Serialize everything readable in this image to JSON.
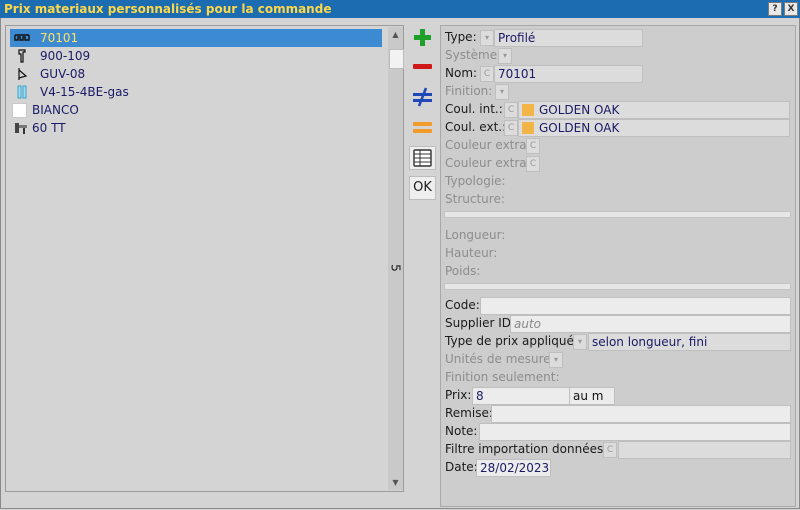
{
  "window": {
    "title": "Prix materiaux personnalisés pour la commande",
    "help_label": "?",
    "close_label": "X"
  },
  "list": {
    "items": [
      {
        "label": "70101",
        "icon": "profile-icon",
        "selected": true
      },
      {
        "label": "900-109",
        "icon": "profile-section-icon"
      },
      {
        "label": "GUV-08",
        "icon": "gasket-icon"
      },
      {
        "label": "V4-15-4BE-gas",
        "icon": "glass-icon"
      },
      {
        "label": "BIANCO",
        "icon": "color-white-icon"
      },
      {
        "label": "60 TT",
        "icon": "hardware-icon"
      }
    ],
    "count": "5"
  },
  "toolbar": {
    "ok_label": "OK"
  },
  "form": {
    "type_label": "Type:",
    "type_value": "Profilé",
    "system_label": "Système:",
    "name_label": "Nom:",
    "name_value": "70101",
    "finish_label": "Finition:",
    "int_color_label": "Coul. int.:",
    "int_color_value": "GOLDEN OAK",
    "ext_color_label": "Coul. ext.:",
    "ext_color_value": "GOLDEN OAK",
    "extra_color1_label": "Couleur extra:",
    "extra_color2_label": "Couleur extra:",
    "typology_label": "Typologie:",
    "structure_label": "Structure:",
    "length_label": "Longueur:",
    "height_label": "Hauteur:",
    "weight_label": "Poids:",
    "code_label": "Code:",
    "supplier_label": "Supplier ID:",
    "supplier_placeholder": "auto",
    "price_type_label": "Type de prix appliqué:",
    "price_type_value": "selon longueur, fini",
    "units_label": "Unités de mesure:",
    "finish_only_label": "Finition seulement:",
    "price_label": "Prix:",
    "price_value": "8",
    "price_unit": "au m",
    "discount_label": "Remise:",
    "note_label": "Note:",
    "import_filter_label": "Filtre importation données:",
    "date_label": "Date:",
    "date_value": "28/02/2023",
    "c_label": "C",
    "swatch_color": "#f2b648"
  }
}
